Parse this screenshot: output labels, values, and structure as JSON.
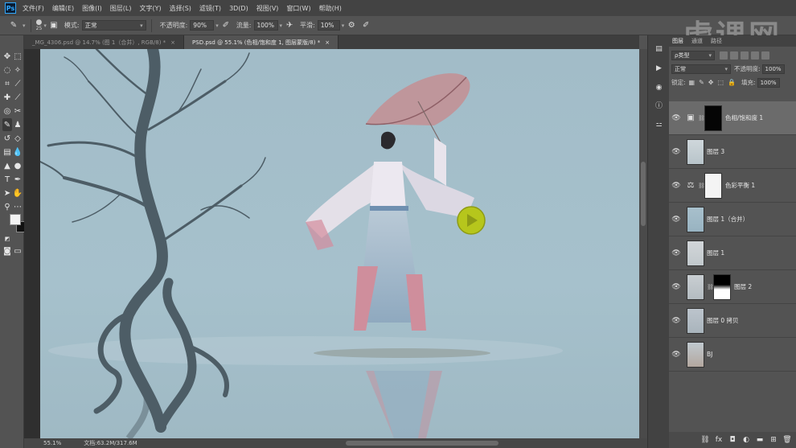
{
  "app": {
    "logo": "Ps",
    "menu": [
      "文件(F)",
      "编辑(E)",
      "图像(I)",
      "图层(L)",
      "文字(Y)",
      "选择(S)",
      "滤镜(T)",
      "3D(D)",
      "视图(V)",
      "窗口(W)",
      "帮助(H)"
    ],
    "watermark": "虎课网"
  },
  "options_bar": {
    "brush_size": "25",
    "mode_label": "模式:",
    "mode_value": "正常",
    "opacity_label": "不透明度:",
    "opacity_value": "90%",
    "flow_label": "流量:",
    "flow_value": "100%",
    "smoothing_label": "平滑:",
    "smoothing_value": "10%"
  },
  "document_tabs": [
    {
      "label": "_MG_4306.psd @ 14.7% (图 1（合并）, RGB/8) *",
      "active": false
    },
    {
      "label": "PSD.psd @ 55.1% (色相/饱和度 1, 图层蒙版/8) *",
      "active": true
    }
  ],
  "status_bar": {
    "zoom": "55.1%",
    "doc_info": "文档:63.2M/317.6M"
  },
  "layers_panel": {
    "tabs": [
      "图层",
      "通道",
      "路径"
    ],
    "filter_kind": "ρ类型",
    "blend_mode": "正常",
    "opacity_label": "不透明度:",
    "opacity_value": "100%",
    "lock_label": "锁定:",
    "fill_label": "填充:",
    "fill_value": "100%",
    "layers": [
      {
        "name": "色相/饱和度 1",
        "kind": "adjustment-hue",
        "selected": true
      },
      {
        "name": "图层 3",
        "kind": "pixel",
        "selected": false
      },
      {
        "name": "色彩平衡 1",
        "kind": "adjustment-balance",
        "selected": false
      },
      {
        "name": "图层 1（合并）",
        "kind": "pixel",
        "selected": false
      },
      {
        "name": "图层 1",
        "kind": "pixel",
        "selected": false
      },
      {
        "name": "图层 2",
        "kind": "pixel-mask",
        "selected": false
      },
      {
        "name": "图层 0 拷贝",
        "kind": "pixel",
        "selected": false
      },
      {
        "name": "BJ",
        "kind": "pixel",
        "selected": false
      }
    ]
  },
  "colors": {
    "ui_dark": "#434343",
    "ui_mid": "#535353",
    "photo_sky": "#a6c0cb",
    "cursor": "#b6c61c"
  }
}
